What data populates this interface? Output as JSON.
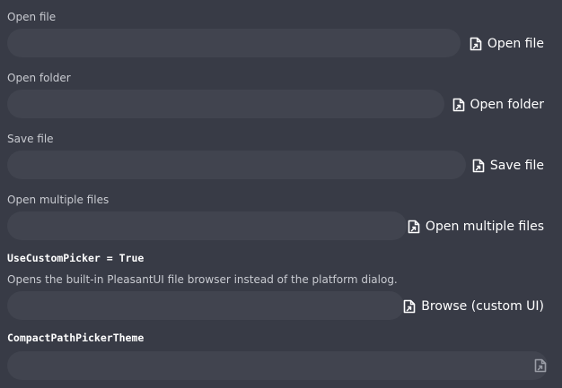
{
  "rows": {
    "open_file": {
      "label": "Open file",
      "button": "Open file",
      "value": ""
    },
    "open_folder": {
      "label": "Open folder",
      "button": "Open folder",
      "value": ""
    },
    "save_file": {
      "label": "Save file",
      "button": "Save file",
      "value": ""
    },
    "open_multiple": {
      "label": "Open multiple files",
      "button": "Open multiple files",
      "value": ""
    },
    "custom": {
      "label": "UseCustomPicker = True",
      "description": "Opens the built-in PleasantUI file browser instead of the platform dialog.",
      "button": "Browse (custom UI)",
      "value": ""
    },
    "compact": {
      "label": "CompactPathPickerTheme",
      "value": ""
    }
  },
  "icons": {
    "button_icon": "file-shortcut-icon"
  }
}
